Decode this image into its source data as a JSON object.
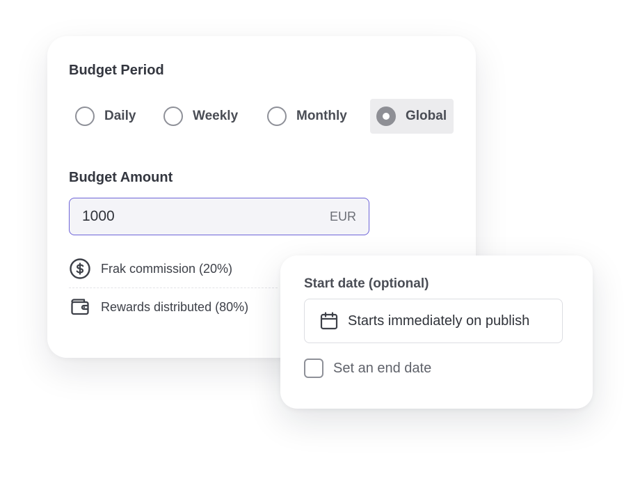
{
  "budget_period": {
    "title": "Budget Period",
    "options": [
      {
        "label": "Daily",
        "selected": false
      },
      {
        "label": "Weekly",
        "selected": false
      },
      {
        "label": "Monthly",
        "selected": false
      },
      {
        "label": "Global",
        "selected": true
      }
    ]
  },
  "budget_amount": {
    "title": "Budget Amount",
    "value": "1000",
    "currency": "EUR"
  },
  "breakdown": {
    "commission": {
      "label": "Frak commission (20%)",
      "icon": "dollar-circle-icon"
    },
    "rewards": {
      "label": "Rewards distributed (80%)",
      "icon": "wallet-icon"
    }
  },
  "start_date": {
    "label": "Start date (optional)",
    "button_text": "Starts immediately on publish",
    "icon": "calendar-icon"
  },
  "end_date": {
    "label": "Set an end date",
    "checked": false
  },
  "colors": {
    "accent_border": "#6d63d8",
    "selected_bg": "#ececee",
    "radio_border": "#8e9098"
  }
}
